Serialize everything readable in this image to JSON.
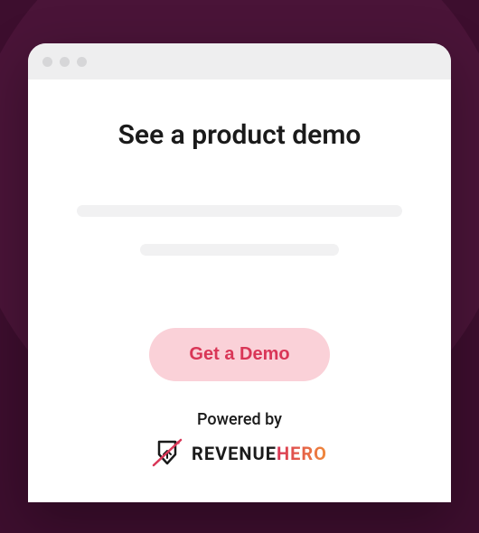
{
  "heading": "See a product demo",
  "cta_label": "Get a Demo",
  "powered_by_label": "Powered by",
  "brand": {
    "name_part1": "REVENUE",
    "name_part2": "HERO"
  },
  "colors": {
    "background": "#3d0e2e",
    "cta_bg": "#fad1d8",
    "cta_text": "#d93657"
  }
}
